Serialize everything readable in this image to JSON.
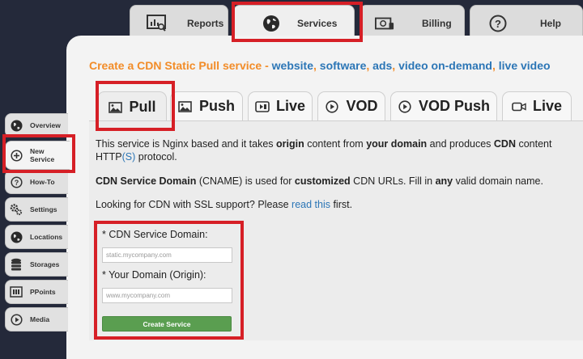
{
  "top_tabs": [
    {
      "label": "Reports",
      "icon": "reports-icon"
    },
    {
      "label": "Services",
      "icon": "globe-icon",
      "active": true
    },
    {
      "label": "Billing",
      "icon": "billing-icon"
    },
    {
      "label": "Help",
      "icon": "help-icon"
    }
  ],
  "heading": {
    "prefix": "Create a CDN Static Pull service - ",
    "website": "website",
    "sep1": ", ",
    "software": "software",
    "sep2": ", ",
    "ads": "ads",
    "sep3": ", ",
    "vod": "video on-demand",
    "sep4": ", ",
    "live": "live video"
  },
  "service_tabs": [
    {
      "label": "Pull",
      "icon": "image-icon",
      "active": true
    },
    {
      "label": "Push",
      "icon": "image-icon"
    },
    {
      "label": "Live",
      "icon": "live-camera-icon"
    },
    {
      "label": "VOD",
      "icon": "play-circle-icon"
    },
    {
      "label": "VOD Push",
      "icon": "play-circle-icon"
    },
    {
      "label": "Live",
      "icon": "video-camera-icon"
    }
  ],
  "info": {
    "p1": {
      "t1": "This service is Nginx based and it takes ",
      "b1": "origin",
      "t2": " content from ",
      "b2": "your domain",
      "t3": " and produces ",
      "b3": "CDN",
      "t4": " content",
      "t5": "HTTP",
      "link": "(S)",
      "t6": " protocol."
    },
    "p2": {
      "b1": "CDN Service Domain",
      "t1": " (CNAME) is used for ",
      "b2": "customized",
      "t2": " CDN URLs. Fill in ",
      "b3": "any",
      "t3": " valid domain name."
    },
    "p3": {
      "t1": "Looking for CDN with SSL support? Please ",
      "link": "read this",
      "t2": " first."
    }
  },
  "form": {
    "cdn_domain_label": "* CDN Service Domain:",
    "cdn_domain_placeholder": "static.mycompany.com",
    "origin_label": "* Your Domain (Origin):",
    "origin_placeholder": "www.mycompany.com",
    "submit_label": "Create Service"
  },
  "sidebar": [
    {
      "label": "Overview",
      "icon": "globe-icon"
    },
    {
      "label": "New Service",
      "icon": "plus-circle-icon",
      "active": true
    },
    {
      "label": "How-To",
      "icon": "question-icon"
    },
    {
      "label": "Settings",
      "icon": "gears-icon"
    },
    {
      "label": "Locations",
      "icon": "globe-icon"
    },
    {
      "label": "Storages",
      "icon": "database-icon"
    },
    {
      "label": "PPoints",
      "icon": "ppoints-icon"
    },
    {
      "label": "Media",
      "icon": "play-circle-icon"
    }
  ],
  "colors": {
    "highlight": "#d61f26",
    "accent_orange": "#f28c28",
    "link_blue": "#2c76b6",
    "button_green": "#5a9e50",
    "background_dark": "#24293a"
  }
}
